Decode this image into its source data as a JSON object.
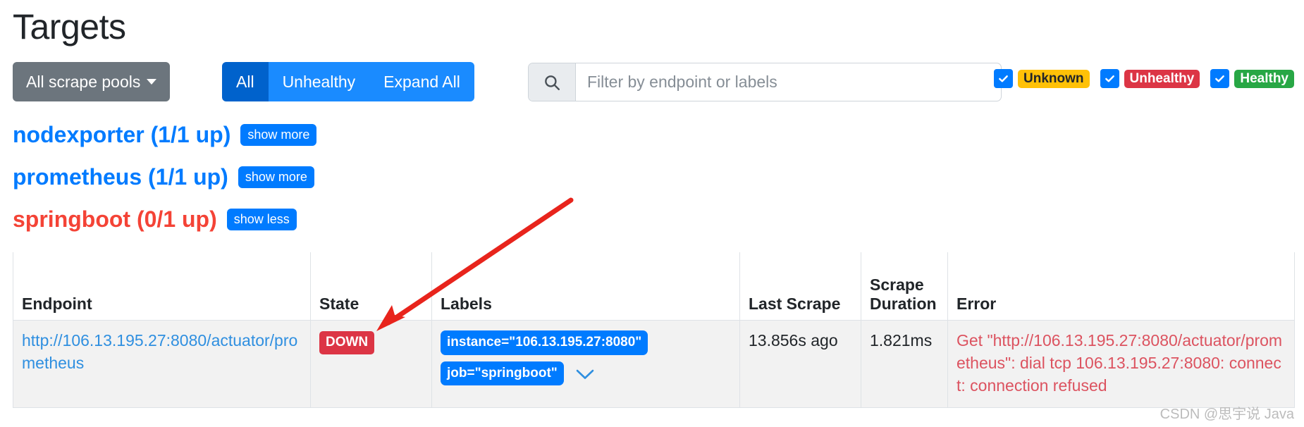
{
  "page": {
    "title": "Targets",
    "watermark": "CSDN @思宇说 Java"
  },
  "toolbar": {
    "pool_dropdown_label": "All scrape pools",
    "buttons": [
      {
        "label": "All",
        "active": true
      },
      {
        "label": "Unhealthy",
        "active": false
      },
      {
        "label": "Expand All",
        "active": false
      }
    ],
    "search": {
      "placeholder": "Filter by endpoint or labels",
      "value": "",
      "icon": "search-icon"
    },
    "status_filters": [
      {
        "label": "Unknown",
        "checked": true,
        "color": "#ffc107"
      },
      {
        "label": "Unhealthy",
        "checked": true,
        "color": "#dc3545"
      },
      {
        "label": "Healthy",
        "checked": true,
        "color": "#28a745"
      }
    ]
  },
  "pools": [
    {
      "title": "nodexporter (1/1 up)",
      "toggle_label": "show more",
      "state": "up"
    },
    {
      "title": "prometheus (1/1 up)",
      "toggle_label": "show more",
      "state": "up"
    },
    {
      "title": "springboot (0/1 up)",
      "toggle_label": "show less",
      "state": "down"
    }
  ],
  "table": {
    "headers": {
      "endpoint": "Endpoint",
      "state": "State",
      "labels": "Labels",
      "last_scrape": "Last Scrape",
      "scrape_duration_line1": "Scrape",
      "scrape_duration_line2": "Duration",
      "error": "Error"
    },
    "rows": [
      {
        "endpoint": "http://106.13.195.27:8080/actuator/prometheus",
        "state": "DOWN",
        "labels": [
          "instance=\"106.13.195.27:8080\"",
          "job=\"springboot\""
        ],
        "last_scrape": "13.856s ago",
        "scrape_duration": "1.821ms",
        "error": "Get \"http://106.13.195.27:8080/actuator/prometheus\": dial tcp 106.13.195.27:8080: connect: connection refused"
      }
    ]
  },
  "colors": {
    "primary": "#007bff",
    "primary_active": "#0062cc",
    "secondary": "#6c757d",
    "danger": "#dc3545",
    "warning": "#ffc107",
    "success": "#28a745",
    "annotation": "#e8241c"
  }
}
